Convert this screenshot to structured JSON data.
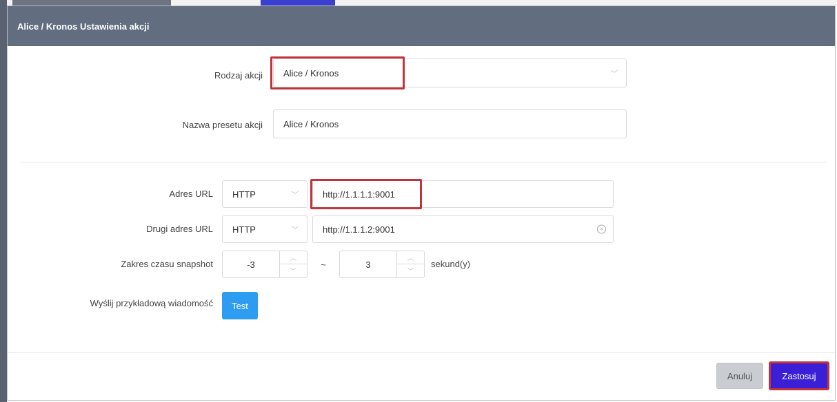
{
  "dialog": {
    "title": "Alice / Kronos Ustawienia akcji"
  },
  "action_type": {
    "label": "Rodzaj akcji",
    "value": "Alice / Kronos"
  },
  "preset_name": {
    "label": "Nazwa presetu akcji",
    "value": "Alice / Kronos"
  },
  "url": {
    "label": "Adres URL",
    "protocol": "HTTP",
    "value": "http://1.1.1.1:9001"
  },
  "second_url": {
    "label": "Drugi adres URL",
    "protocol": "HTTP",
    "value": "http://1.1.1.2:9001"
  },
  "snapshot_range": {
    "label": "Zakres czasu snapshot",
    "from": "-3",
    "separator": "~",
    "to": "3",
    "unit": "sekund(y)"
  },
  "test_message": {
    "label": "Wyślij przykładową wiadomość",
    "button": "Test"
  },
  "footer": {
    "cancel": "Anuluj",
    "apply": "Zastosuj"
  },
  "icons": {
    "dropdown": "chevron-down-icon",
    "clear": "clear-circle-icon",
    "spin_up": "chevron-up-icon",
    "spin_down": "chevron-down-icon"
  },
  "colors": {
    "header": "#626d80",
    "highlight": "#c0343b",
    "test_button": "#2e9cf0",
    "apply_button": "#3b1fd6",
    "cancel_button": "#c9ccd1"
  }
}
